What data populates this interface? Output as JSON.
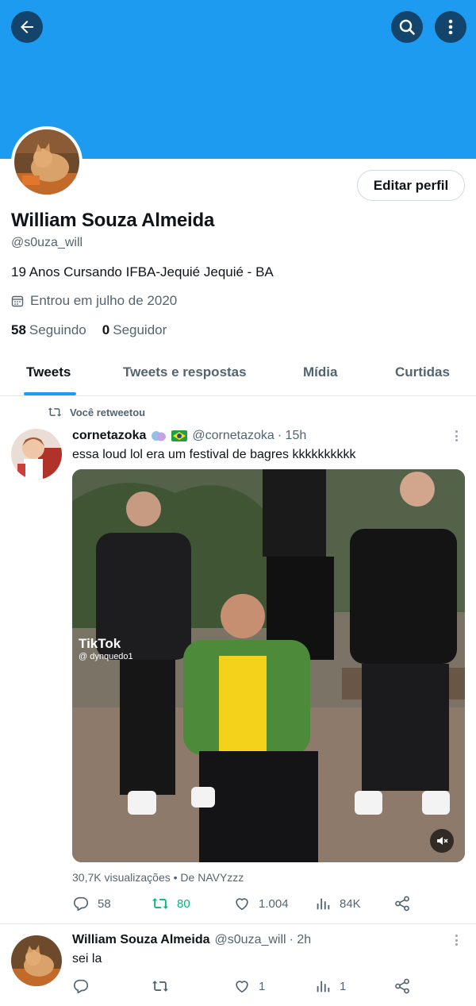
{
  "profile": {
    "name": "William Souza Almeida",
    "handle": "@s0uza_will",
    "bio": "19 Anos Cursando IFBA-Jequié Jequié - BA",
    "joined": "Entrou em julho de 2020",
    "following_count": "58",
    "following_label": "Seguindo",
    "followers_count": "0",
    "followers_label": "Seguidor",
    "edit_label": "Editar perfil"
  },
  "tabs": [
    {
      "label": "Tweets",
      "active": true
    },
    {
      "label": "Tweets e respostas",
      "active": false
    },
    {
      "label": "Mídia",
      "active": false
    },
    {
      "label": "Curtidas",
      "active": false
    }
  ],
  "tweets": [
    {
      "retweet_label": "Você retweetou",
      "display_name": "cornetazoka",
      "handle": "@cornetazoka",
      "time": "· 15h",
      "text": "essa loud lol era um festival de bagres kkkkkkkkkk",
      "media_watermark": "TikTok",
      "media_user": "@ dynquedo1",
      "views": "30,7K visualizações • De NAVYzzz",
      "replies": "58",
      "retweets": "80",
      "likes": "1.004",
      "analytics": "84K"
    },
    {
      "display_name": "William Souza Almeida",
      "handle": "@s0uza_will",
      "time": "· 2h",
      "text": "sei la",
      "replies": "",
      "retweets": "",
      "likes": "1",
      "analytics": "1"
    }
  ],
  "colors": {
    "banner": "#1d9bf0",
    "accent": "#1d9bf0",
    "retweet_active": "#00ba7c",
    "muted_text": "#536471"
  },
  "icons": [
    "back-arrow-icon",
    "search-icon",
    "more-vertical-icon",
    "calendar-icon",
    "retweet-icon",
    "reply-icon",
    "like-icon",
    "analytics-icon",
    "share-icon",
    "mute-icon"
  ]
}
